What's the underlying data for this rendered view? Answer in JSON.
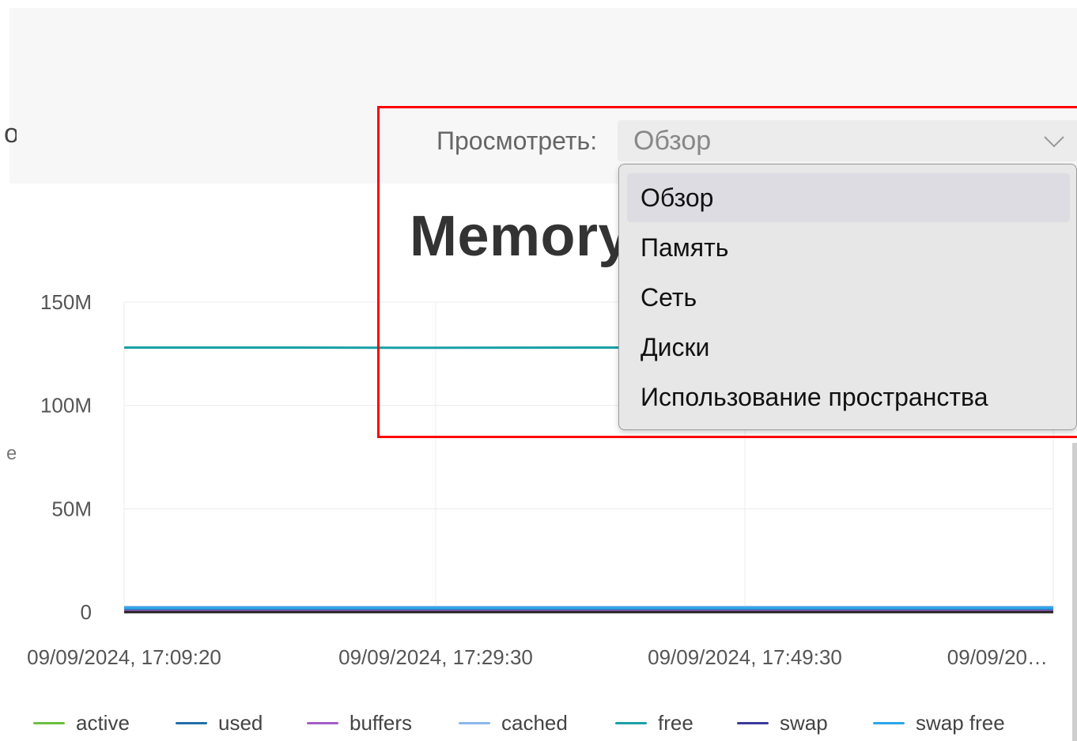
{
  "header": {
    "title_fragment": "o",
    "view_label": "Просмотреть:",
    "view_select": {
      "value": "Обзор",
      "options": [
        "Обзор",
        "Память",
        "Сеть",
        "Диски",
        "Использование пространства"
      ],
      "selected_index": 0
    }
  },
  "section": {
    "title": "Memory"
  },
  "chart": {
    "ylabel_fragment": "e"
  },
  "chart_data": {
    "type": "line",
    "title": "Memory",
    "xlabel": "",
    "ylabel": "",
    "x_ticks": [
      "09/09/2024, 17:09:20",
      "09/09/2024, 17:29:30",
      "09/09/2024, 17:49:30",
      "09/09/20…"
    ],
    "y_ticks": [
      "150M",
      "100M",
      "50M",
      "0"
    ],
    "ylim": [
      0,
      150000000
    ],
    "grid": true,
    "legend_position": "bottom",
    "series": [
      {
        "name": "active",
        "color": "#6abf40",
        "values": [
          1500000,
          1500000,
          1500000,
          1500000,
          1500000,
          1500000,
          1500000
        ]
      },
      {
        "name": "used",
        "color": "#1f6fa8",
        "values": [
          1000000,
          1000000,
          1000000,
          1000000,
          1000000,
          1000000,
          1000000
        ]
      },
      {
        "name": "buffers",
        "color": "#a45ec8",
        "values": [
          500000,
          500000,
          500000,
          500000,
          500000,
          500000,
          500000
        ]
      },
      {
        "name": "cached",
        "color": "#8ab8ea",
        "values": [
          2500000,
          2500000,
          2500000,
          2500000,
          2500000,
          2500000,
          2500000
        ]
      },
      {
        "name": "free",
        "color": "#1aa0a8",
        "values": [
          128000000,
          128000000,
          127900000,
          128000000,
          128000000,
          128000000,
          128000000
        ]
      },
      {
        "name": "swap",
        "color": "#3a3a9a",
        "values": [
          0,
          0,
          0,
          0,
          0,
          0,
          0
        ]
      },
      {
        "name": "swap free",
        "color": "#2aa6e8",
        "values": [
          2000000,
          2000000,
          2000000,
          2000000,
          2000000,
          2000000,
          2000000
        ]
      }
    ]
  }
}
